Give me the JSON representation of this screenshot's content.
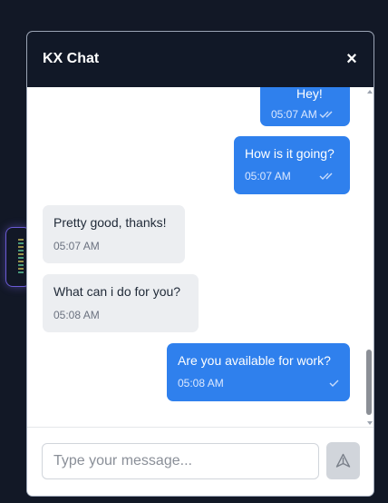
{
  "chat": {
    "title": "KX Chat",
    "close_label": "×",
    "messages": [
      {
        "direction": "outgoing",
        "text": "Hey!",
        "time": "05:07 AM",
        "status": "read"
      },
      {
        "direction": "outgoing",
        "text": "How is it going?",
        "time": "05:07 AM",
        "status": "read"
      },
      {
        "direction": "incoming",
        "text": "Pretty good, thanks!",
        "time": "05:07 AM"
      },
      {
        "direction": "incoming",
        "text": "What can i do for you?",
        "time": "05:08 AM"
      },
      {
        "direction": "outgoing",
        "text": "Are you available for work?",
        "time": "05:08 AM",
        "status": "sent"
      }
    ],
    "input": {
      "placeholder": "Type your message...",
      "value": ""
    },
    "send_icon": "send-icon"
  },
  "colors": {
    "header_bg": "#111827",
    "outgoing_bubble": "#2f80ed",
    "incoming_bubble": "#eceef1",
    "send_button_disabled": "#d1d5db"
  }
}
